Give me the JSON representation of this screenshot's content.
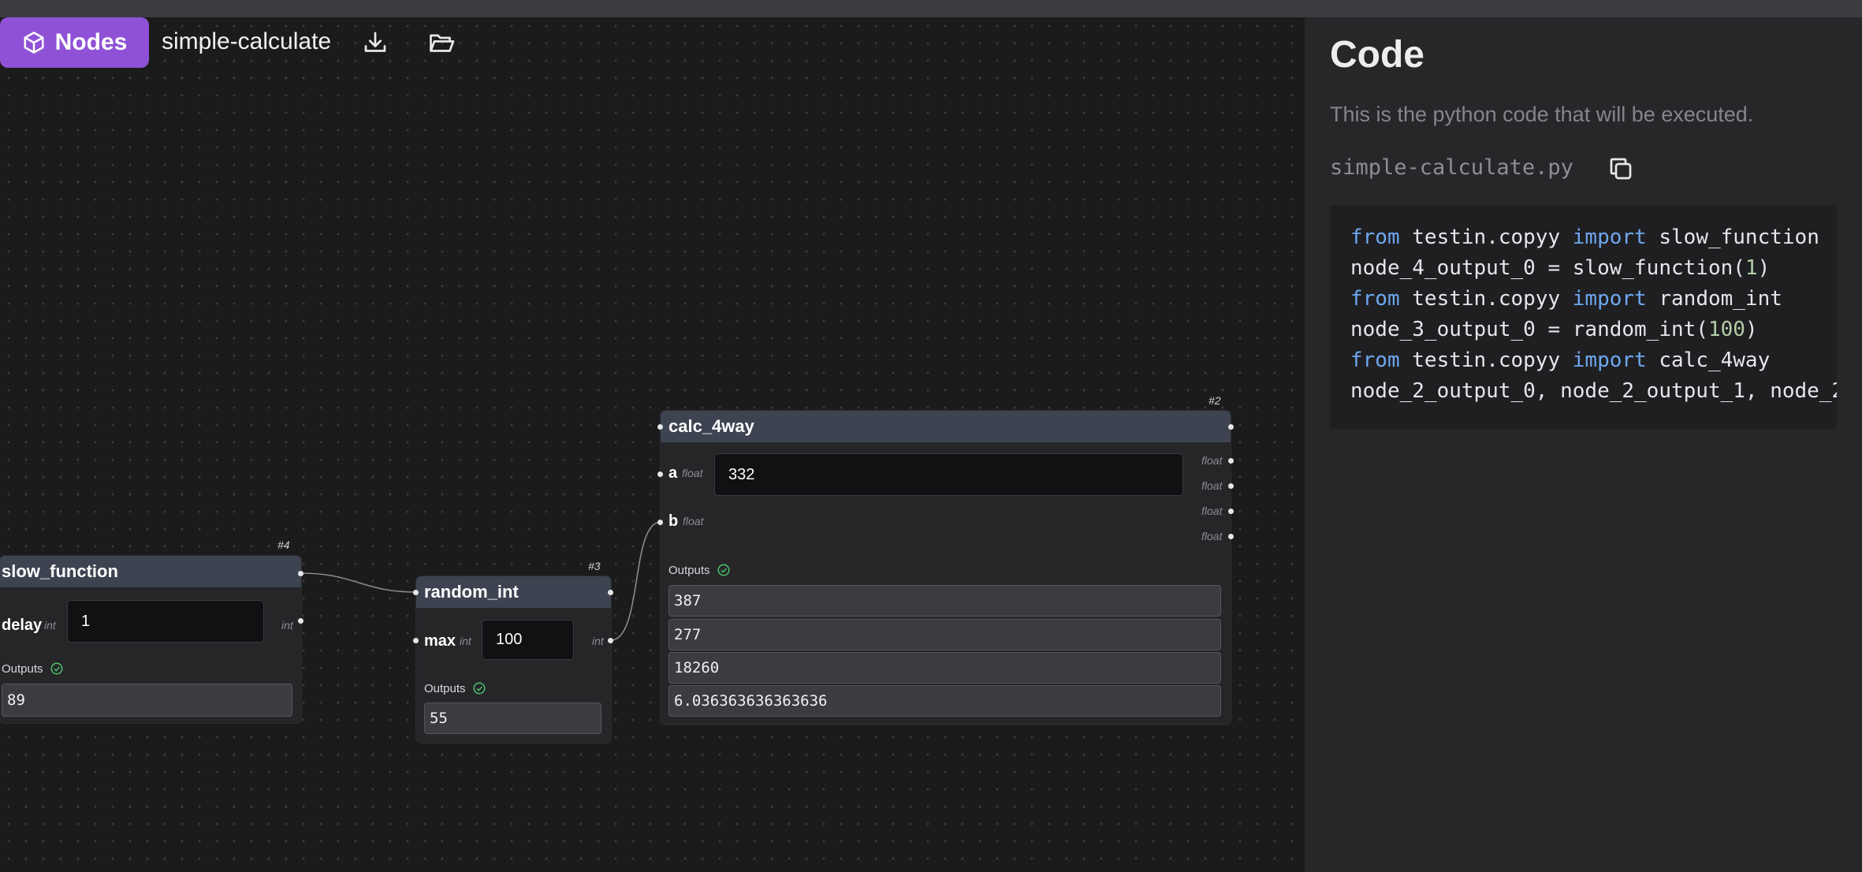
{
  "app": {
    "brand_label": "Nodes",
    "project_name": "simple-calculate"
  },
  "toolbar": {
    "download_icon": "download-icon",
    "open_icon": "folder-open-icon"
  },
  "nodes": {
    "slow_function": {
      "id": "#4",
      "title": "slow_function",
      "param_name": "delay",
      "param_type": "int",
      "param_value": "1",
      "output_type": "int",
      "outputs_label": "Outputs",
      "outputs": [
        "89"
      ]
    },
    "random_int": {
      "id": "#3",
      "title": "random_int",
      "param_name": "max",
      "param_type": "int",
      "param_value": "100",
      "output_type": "int",
      "outputs_label": "Outputs",
      "outputs": [
        "55"
      ]
    },
    "calc_4way": {
      "id": "#2",
      "title": "calc_4way",
      "param_a_name": "a",
      "param_a_type": "float",
      "param_a_value": "332",
      "param_b_name": "b",
      "param_b_type": "float",
      "output_types": [
        "float",
        "float",
        "float",
        "float"
      ],
      "outputs_label": "Outputs",
      "outputs": [
        "387",
        "277",
        "18260",
        "6.036363636363636"
      ]
    }
  },
  "panel": {
    "title": "Code",
    "description": "This is the python code that will be executed.",
    "filename": "simple-calculate.py",
    "copy_icon": "copy-icon",
    "code": [
      "from testin.copyy import slow_function",
      "node_4_output_0 = slow_function(1)",
      "from testin.copyy import random_int",
      "node_3_output_0 = random_int(100)",
      "from testin.copyy import calc_4way",
      "node_2_output_0, node_2_output_1, node_2"
    ]
  },
  "colors": {
    "accent": "#8f52d6",
    "node_header": "#3d4350",
    "success": "#4cc36a"
  }
}
